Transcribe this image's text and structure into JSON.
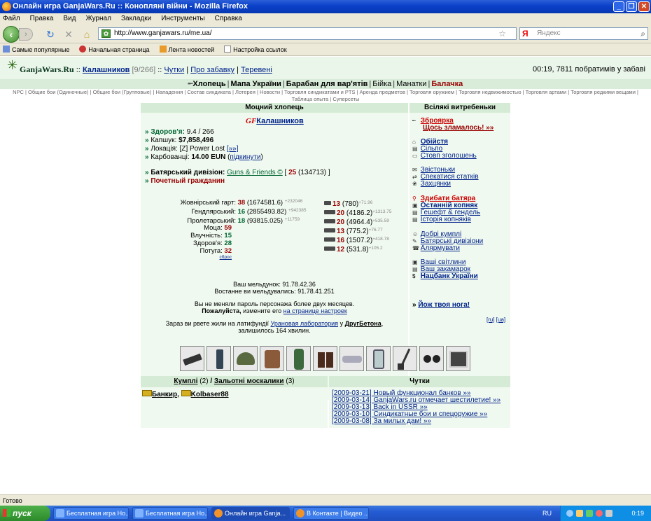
{
  "window": {
    "title": "Онлайн игра GanjaWars.Ru :: Коноплянi вiйни - Mozilla Firefox"
  },
  "menu": [
    "Файл",
    "Правка",
    "Вид",
    "Журнал",
    "Закладки",
    "Инструменты",
    "Справка"
  ],
  "nav": {
    "url": "http://www.ganjawars.ru/me.ua/",
    "search_placeholder": "Яндекс"
  },
  "bookmarks": [
    "Самые популярные",
    "Начальная страница",
    "Лента новостей",
    "Настройка ссылок"
  ],
  "top": {
    "site": "GanjaWars.Ru",
    "sep1": "::",
    "user": "Калашников",
    "level": "[9/266]",
    "sep2": "::",
    "links": [
      "Чутки",
      "Про забавку",
      "Теревені"
    ],
    "right": "00:19, 7811 побратимів у забаві"
  },
  "mainnav": [
    "Хлопець",
    "Мапа України",
    "Барабан для вар'ятів",
    "Бiйка",
    "Манатки",
    "Балачка"
  ],
  "subnav": "NPC | Общие бои (Одиночные) | Общие бои (Групповые) | Нападения | Состав синдиката | Лотерея | Новости | Торговля синдикатами и PTS | Аренда предметов | Торговля оружием | Торговля недвижимостью | Торговля артами | Торговля редкими вещами | Таблица опыта | Суперсеты",
  "left": {
    "title": "Моцний хлопець",
    "gf": "GF",
    "name": "Калашников",
    "health_label": "Здоров'я:",
    "health": "9.4 / 266",
    "wallet_label": "Капшук:",
    "wallet": "$7,858,496",
    "location_label": "Локація:",
    "location": "[Z] Power Lost",
    "location_link": "[»»]",
    "eun_label": "Карбованці:",
    "eun": "14.00 EUN",
    "eun_link": "підкинути",
    "div_label": "Батярський дивізіон:",
    "div_name": "Guns & Friends ©",
    "div_level": "25",
    "div_exp": "(134713)",
    "title2": "Почетный гражданин"
  },
  "skills": [
    {
      "label": "Жовнірський гарт:",
      "lvl": "38",
      "exp": "(1674581.6)",
      "gain": "+232046"
    },
    {
      "label": "Гендлярський:",
      "lvl": "16",
      "exp": "(2855493.82)",
      "gain": "+942385"
    },
    {
      "label": "Пролетарський:",
      "lvl": "18",
      "exp": "(93815.025)",
      "gain": "+11759"
    }
  ],
  "attrs": [
    {
      "label": "Моца:",
      "val": "59"
    },
    {
      "label": "Влучність:",
      "val": "15"
    },
    {
      "label": "Здоров'я:",
      "val": "28"
    },
    {
      "label": "Потуга:",
      "val": "32"
    }
  ],
  "reset": "сброс",
  "weapons": [
    {
      "lvl": "13",
      "exp": "(780)",
      "gain": "+71.96"
    },
    {
      "lvl": "20",
      "exp": "(4186.2)",
      "gain": "+1313.75"
    },
    {
      "lvl": "20",
      "exp": "(4964.4)",
      "gain": "+535.59"
    },
    {
      "lvl": "13",
      "exp": "(775.2)",
      "gain": "+76.77"
    },
    {
      "lvl": "16",
      "exp": "(1507.2)",
      "gain": "+418.78"
    },
    {
      "lvl": "12",
      "exp": "(531.8)",
      "gain": "+105.2"
    }
  ],
  "ip": {
    "line1": "Ваш мельдунок: 91.78.42.36",
    "line2": "Востанне ви мельдувались: 91.78.41.251",
    "line3": "Вы не меняли пароль персонажа более двух месяцев.",
    "line4a": "Пожалуйста,",
    "line4b": "измените его",
    "line4c": "на странице настроек",
    "line5a": "Зараз ви рвете жили на латифундії",
    "line5b": "Урановая лаборатория",
    "line5c": "у",
    "line5d": "ДругБетона",
    "line6": "залишилось 164 хвилин."
  },
  "right": {
    "title": "Всілякі витребеньки",
    "armory": "Зброярка",
    "broken": "Щось зламалось! »»",
    "g1": [
      "Обійстя",
      "Сільпо",
      "Стовп зголошень"
    ],
    "g2": [
      "Звістоньки",
      "Спекатися статків",
      "Захцянки"
    ],
    "g3": [
      "Здибати батяра",
      "Останній копняк",
      "Гешефт & гендель",
      "Історія копняків"
    ],
    "g4": [
      "Добрі кумплі",
      "Батярські дивізіони",
      "Алярмувати"
    ],
    "g5": [
      "Ваші світлини",
      "Ваш закамарок",
      "Нацбанк України"
    ],
    "leg": "Йож твоя нога!",
    "lang": [
      "[ru]",
      "[ua]"
    ]
  },
  "friends": {
    "title_a": "Кумплі",
    "count_a": "(2)",
    "title_sep": "/",
    "title_b": "Зальотні москалики",
    "count_b": "(3)",
    "items": [
      "Банкир",
      "Kolbaser88"
    ]
  },
  "news": {
    "title": "Чутки",
    "items": [
      "[2009-03-21] Новый функционал банков »»",
      "[2009-03-14] GanjaWars.ru отмечает шестилетие! »»",
      "[2009-03-13] Back in USSR »»",
      "[2009-03-10] Синдикатные бои и спецоружие »»",
      "[2009-03-08] За милых дам! »»"
    ]
  },
  "status": "Готово",
  "taskbar": {
    "start": "пуск",
    "items": [
      "Бесплатная игра Но...",
      "Бесплатная игра Но...",
      "Онлайн игра Ganja...",
      "В Контакте | Видео ..."
    ],
    "lang": "RU",
    "clock": "0:19"
  }
}
